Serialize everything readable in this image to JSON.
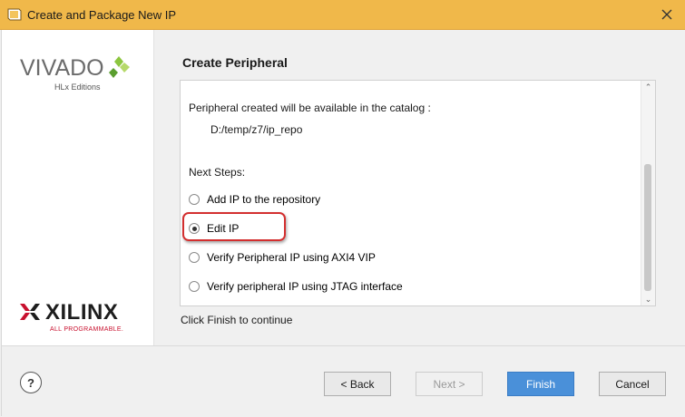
{
  "window": {
    "title": "Create and Package New IP"
  },
  "branding": {
    "product": "VIVADO",
    "product_sub": "HLx Editions",
    "company": "XILINX",
    "company_sub": "ALL PROGRAMMABLE."
  },
  "page": {
    "title": "Create Peripheral",
    "info_text": "Peripheral created will be available in the catalog :",
    "repo_path": "D:/temp/z7/ip_repo",
    "next_steps_label": "Next Steps:",
    "options": [
      {
        "label": "Add IP to the repository",
        "selected": false
      },
      {
        "label": "Edit IP",
        "selected": true
      },
      {
        "label": "Verify Peripheral IP using AXI4 VIP",
        "selected": false
      },
      {
        "label": "Verify peripheral IP using JTAG interface",
        "selected": false
      }
    ],
    "hint": "Click Finish to continue"
  },
  "buttons": {
    "help": "?",
    "back": "< Back",
    "next": "Next >",
    "finish": "Finish",
    "cancel": "Cancel"
  },
  "colors": {
    "titlebar": "#f0b84a",
    "highlight": "#d32f2f",
    "finish": "#4a90d9"
  }
}
